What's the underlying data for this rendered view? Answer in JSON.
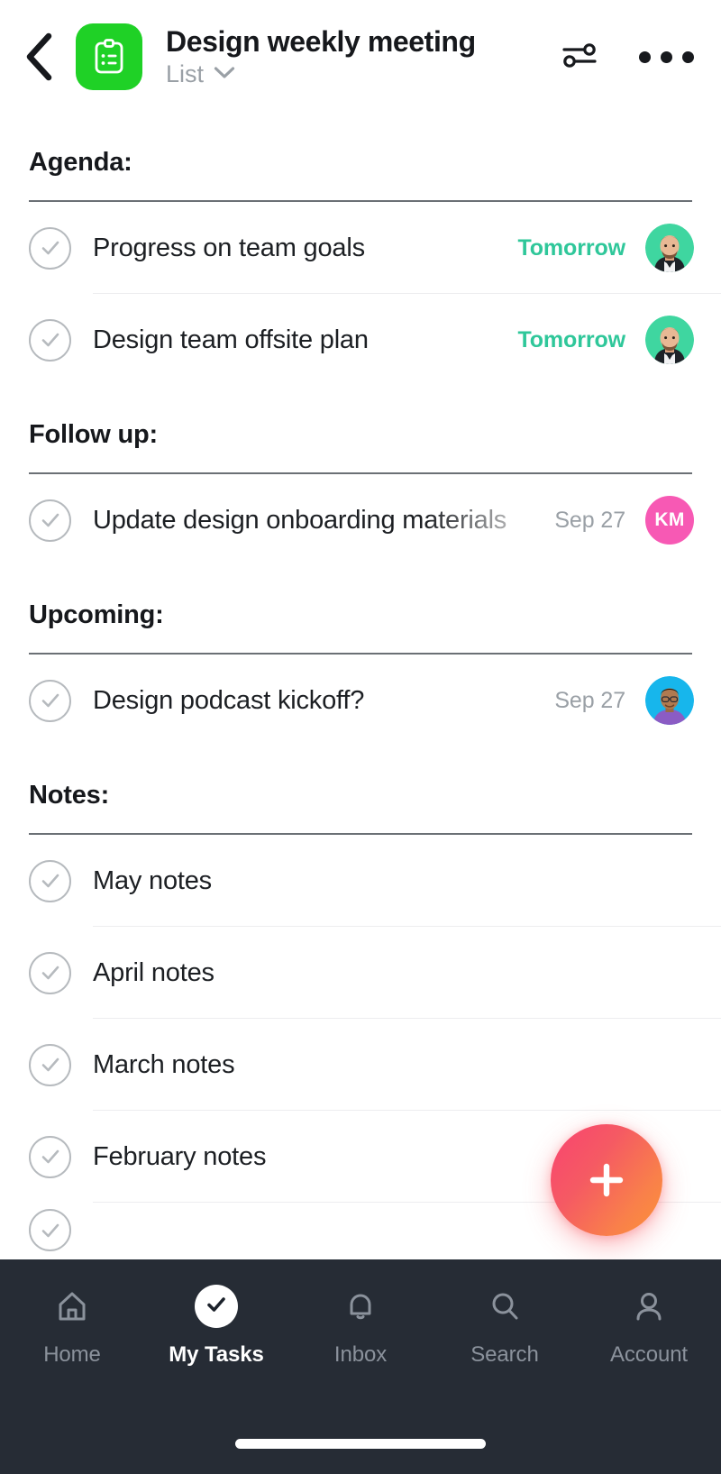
{
  "header": {
    "back_icon": "chevron-left-icon",
    "project_icon": "clipboard-list-icon",
    "project_icon_color": "#1FD126",
    "title": "Design weekly meeting",
    "view_label": "List",
    "view_chevron_icon": "chevron-down-icon",
    "filter_icon": "filter-sliders-icon",
    "more_icon": "more-horizontal-icon"
  },
  "sections": [
    {
      "heading": "Agenda:",
      "tasks": [
        {
          "title": "Progress on team goals",
          "due": "Tomorrow",
          "due_style": "soon",
          "due_color": "#2FC79A",
          "checkbox_icon": "check-circle-icon",
          "assignee": {
            "type": "photo",
            "name": "bearded-man-avatar",
            "bg": "#3FD6A0"
          },
          "truncated": false
        },
        {
          "title": "Design team offsite plan",
          "due": "Tomorrow",
          "due_style": "soon",
          "due_color": "#2FC79A",
          "checkbox_icon": "check-circle-icon",
          "assignee": {
            "type": "photo",
            "name": "bearded-man-avatar",
            "bg": "#3FD6A0"
          },
          "truncated": false
        }
      ]
    },
    {
      "heading": "Follow up:",
      "tasks": [
        {
          "title": "Update design onboarding materials",
          "due": "Sep 27",
          "due_style": "normal",
          "due_color": "#9AA0A6",
          "checkbox_icon": "check-circle-icon",
          "assignee": {
            "type": "initials",
            "initials": "KM",
            "bg": "#F759B4"
          },
          "truncated": true
        }
      ]
    },
    {
      "heading": "Upcoming:",
      "tasks": [
        {
          "title": "Design podcast kickoff?",
          "due": "Sep 27",
          "due_style": "normal",
          "due_color": "#9AA0A6",
          "checkbox_icon": "check-circle-icon",
          "assignee": {
            "type": "photo",
            "name": "glasses-man-avatar",
            "bg": "#17B6EC"
          },
          "truncated": false
        }
      ]
    },
    {
      "heading": "Notes:",
      "tasks": [
        {
          "title": "May notes",
          "due": "",
          "due_style": "normal",
          "checkbox_icon": "check-circle-icon",
          "assignee": null,
          "truncated": false
        },
        {
          "title": "April notes",
          "due": "",
          "due_style": "normal",
          "checkbox_icon": "check-circle-icon",
          "assignee": null,
          "truncated": false
        },
        {
          "title": "March notes",
          "due": "",
          "due_style": "normal",
          "checkbox_icon": "check-circle-icon",
          "assignee": null,
          "truncated": false
        },
        {
          "title": "February notes",
          "due": "",
          "due_style": "normal",
          "checkbox_icon": "check-circle-icon",
          "assignee": null,
          "truncated": false
        },
        {
          "title": "",
          "due": "",
          "due_style": "normal",
          "checkbox_icon": "check-circle-icon",
          "assignee": null,
          "truncated": false
        }
      ]
    }
  ],
  "fab": {
    "icon": "plus-icon",
    "gradient_from": "#FB4D6E",
    "gradient_to": "#FB9238"
  },
  "bottom_nav": {
    "background": "#262C35",
    "items": [
      {
        "label": "Home",
        "icon": "home-icon",
        "active": false
      },
      {
        "label": "My Tasks",
        "icon": "check-icon",
        "active": true
      },
      {
        "label": "Inbox",
        "icon": "bell-icon",
        "active": false
      },
      {
        "label": "Search",
        "icon": "search-icon",
        "active": false
      },
      {
        "label": "Account",
        "icon": "person-icon",
        "active": false
      }
    ]
  }
}
